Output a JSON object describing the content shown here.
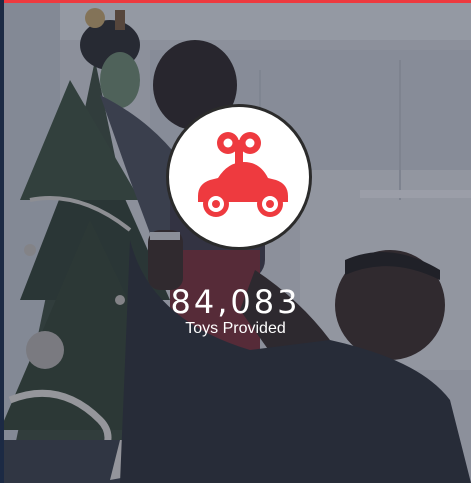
{
  "stat": {
    "value": "84,083",
    "label": "Toys Provided"
  },
  "icon": {
    "name": "wind-up-toy-car-icon",
    "color": "#ee3a3f"
  },
  "colors": {
    "accent": "#ee3a3f",
    "overlay": "#2b3447",
    "text": "#ffffff"
  }
}
